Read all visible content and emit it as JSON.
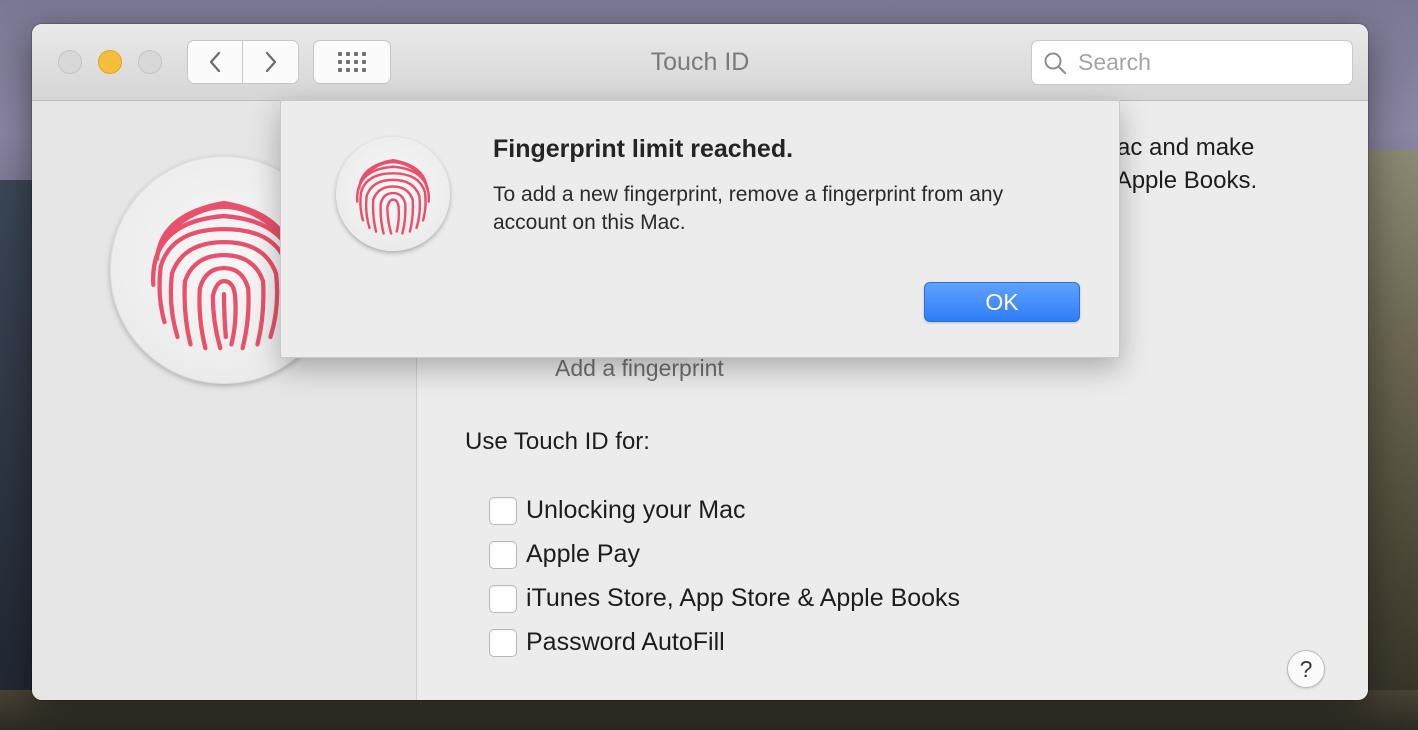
{
  "window": {
    "title": "Touch ID"
  },
  "toolbar": {
    "back_icon": "chevron-left-icon",
    "forward_icon": "chevron-right-icon",
    "grid_icon": "grid-icon"
  },
  "search": {
    "placeholder": "Search",
    "value": ""
  },
  "content": {
    "intro_line1": "Mac and make",
    "intro_line2": "d Apple Books.",
    "add_fingerprint_label": "Add a fingerprint",
    "use_title": "Use Touch ID for:",
    "options": [
      {
        "label": "Unlocking your Mac",
        "checked": false
      },
      {
        "label": "Apple Pay",
        "checked": false
      },
      {
        "label": "iTunes Store, App Store & Apple Books",
        "checked": false
      },
      {
        "label": "Password AutoFill",
        "checked": false
      }
    ],
    "help_label": "?"
  },
  "alert": {
    "title": "Fingerprint limit reached.",
    "message": "To add a new fingerprint, remove a fingerprint from any account on this Mac.",
    "ok_label": "OK"
  },
  "colors": {
    "fingerprint": "#e9506b",
    "accent": "#2f7cf6",
    "minimize": "#f6bd3b"
  }
}
